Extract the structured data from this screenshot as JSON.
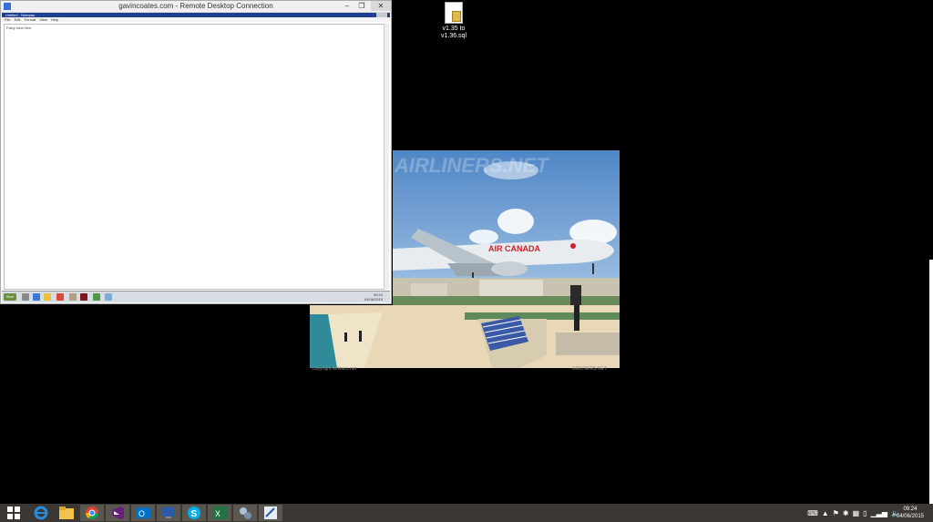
{
  "rdp_window": {
    "title": "gavincoates.com - Remote Desktop Connection",
    "minimize_label": "–",
    "restore_label": "❐",
    "close_label": "✕"
  },
  "notepad": {
    "title": "Untitled - Notepad",
    "menu": [
      "File",
      "Edit",
      "Format",
      "View",
      "Help"
    ],
    "text": "Fairly short text"
  },
  "inner_taskbar": {
    "start_label": "Start",
    "clock_time": "09:24",
    "clock_date": "04/06/2015"
  },
  "desktop_icon": {
    "label_line1": "v1.35 to",
    "label_line2": "v1.36.sql",
    "icon": "sql-file-icon"
  },
  "photo": {
    "watermark": "AIRLINERS.NET",
    "airline_livery": "AIR CANADA",
    "caption_left": "Copyright Airliners.net",
    "caption_right": "AIRLINERS.NET"
  },
  "taskbar": {
    "apps": [
      {
        "name": "start-button",
        "icon": "windows-logo-icon"
      },
      {
        "name": "internet-explorer",
        "icon": "ie-icon"
      },
      {
        "name": "file-explorer",
        "icon": "folder-icon"
      },
      {
        "name": "chrome",
        "icon": "chrome-icon"
      },
      {
        "name": "visual-studio",
        "icon": "visual-studio-icon"
      },
      {
        "name": "outlook",
        "icon": "outlook-icon"
      },
      {
        "name": "remote-desktop",
        "icon": "remote-desktop-icon"
      },
      {
        "name": "skype",
        "icon": "skype-icon"
      },
      {
        "name": "excel",
        "icon": "excel-icon"
      },
      {
        "name": "app-settings",
        "icon": "gears-icon"
      },
      {
        "name": "app-editor",
        "icon": "editor-icon"
      }
    ],
    "clock_time": "09:24",
    "clock_date": "04/06/2015"
  }
}
